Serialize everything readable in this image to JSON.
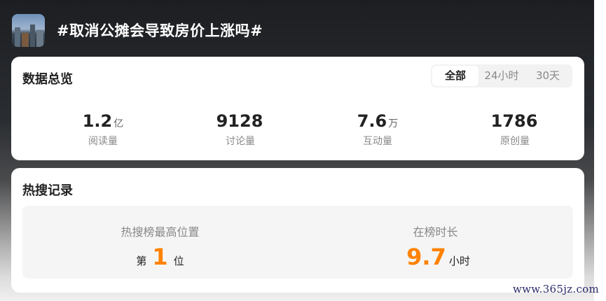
{
  "topic": {
    "title": "#取消公摊会导致房价上涨吗#",
    "thumbnail_icon": "city-skyline-thumbnail"
  },
  "overview": {
    "title": "数据总览",
    "tabs": [
      {
        "label": "全部",
        "active": true
      },
      {
        "label": "24小时",
        "active": false
      },
      {
        "label": "30天",
        "active": false
      }
    ],
    "stats": [
      {
        "value": "1.2",
        "unit": "亿",
        "label": "阅读量"
      },
      {
        "value": "9128",
        "unit": "",
        "label": "讨论量"
      },
      {
        "value": "7.6",
        "unit": "万",
        "label": "互动量"
      },
      {
        "value": "1786",
        "unit": "",
        "label": "原创量"
      }
    ]
  },
  "hot_search": {
    "title": "热搜记录",
    "highest_position": {
      "label": "热搜榜最高位置",
      "prefix": "第",
      "value": "1",
      "suffix": "位"
    },
    "duration": {
      "label": "在榜时长",
      "value": "9.7",
      "suffix": "小时"
    }
  },
  "watermark": "www.365jz.com",
  "colors": {
    "accent": "#ff8200",
    "header_bg": "#1c1e22"
  }
}
